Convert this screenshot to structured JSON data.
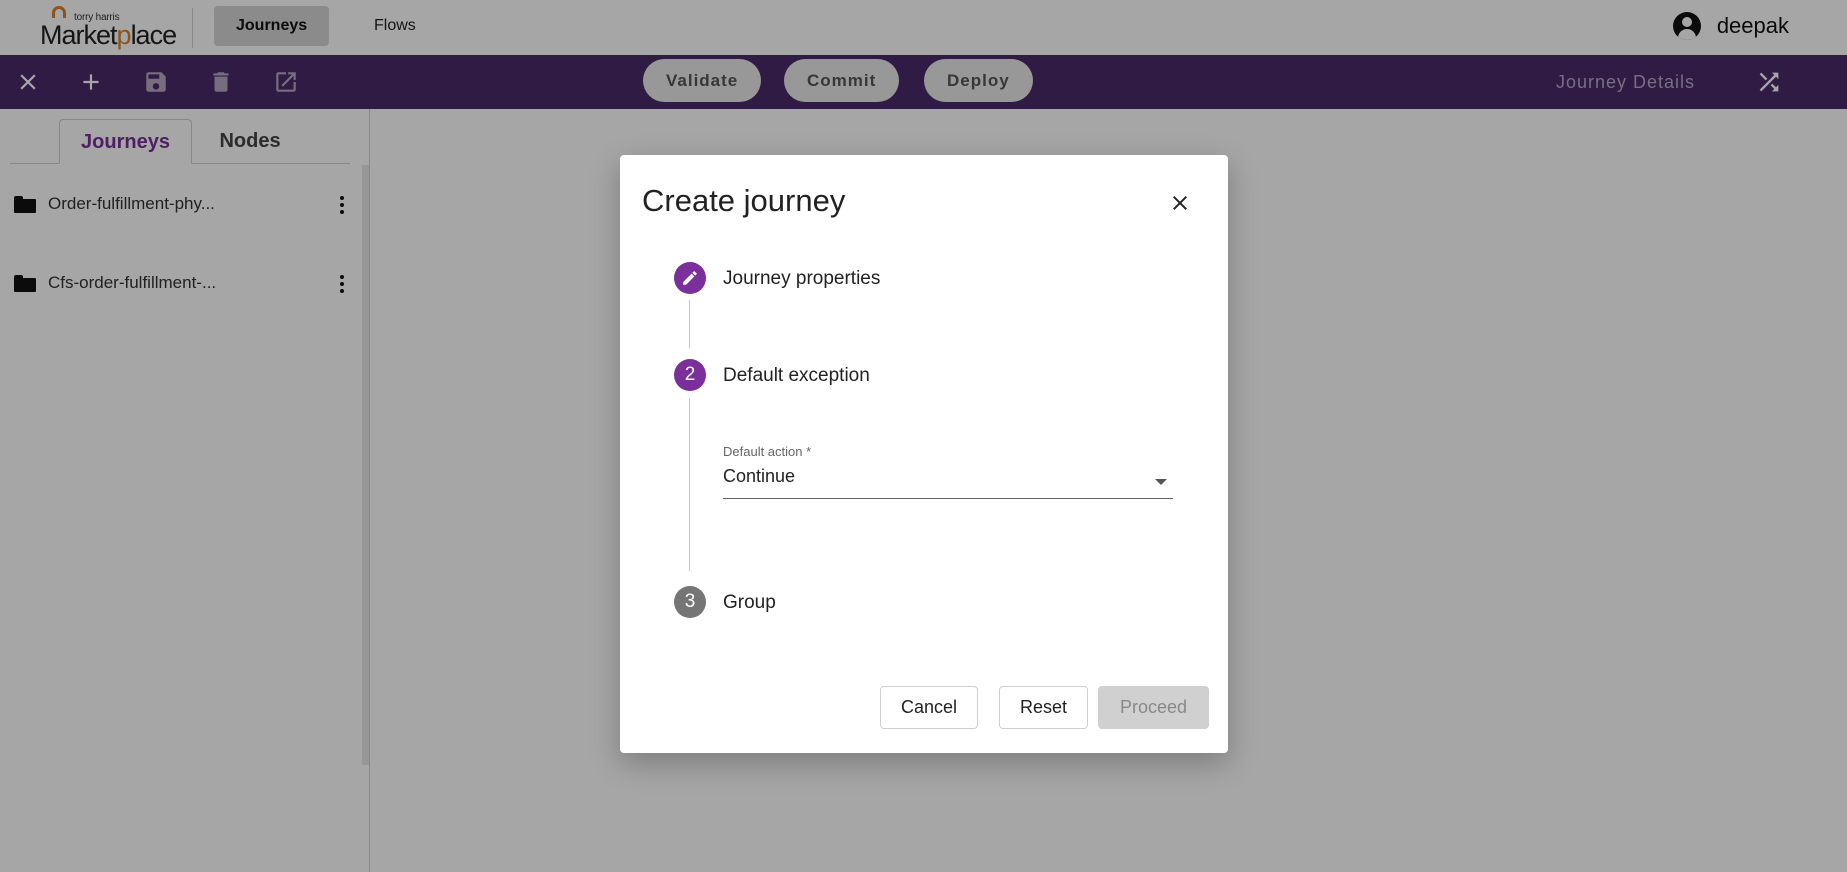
{
  "header": {
    "logo": {
      "small": "torry harris",
      "big_pre": "M",
      "big_mid": "arket",
      "big_accent": "p",
      "big_post": "lace"
    },
    "nav": [
      {
        "label": "Journeys",
        "active": true
      },
      {
        "label": "Flows",
        "active": false
      }
    ],
    "user": {
      "name": "deepak",
      "icon": "account-circle-icon"
    }
  },
  "toolbar": {
    "icons": [
      "close-icon",
      "add-icon",
      "save-icon",
      "delete-icon",
      "open-external-icon"
    ],
    "actions": [
      "Validate",
      "Commit",
      "Deploy"
    ],
    "details_label": "Journey Details",
    "shuffle_icon": "shuffle-icon",
    "background": "#4a2a6a"
  },
  "sidebar": {
    "tabs": [
      {
        "label": "Journeys",
        "active": true
      },
      {
        "label": "Nodes",
        "active": false
      }
    ],
    "items": [
      {
        "label": "Order-fulfillment-phy...",
        "icon": "folder-icon"
      },
      {
        "label": "Cfs-order-fulfillment-...",
        "icon": "folder-icon"
      }
    ]
  },
  "modal": {
    "title": "Create journey",
    "steps": [
      {
        "number": "",
        "label": "Journey properties",
        "state": "completed",
        "icon": "edit-pencil-icon"
      },
      {
        "number": "2",
        "label": "Default exception",
        "state": "active"
      },
      {
        "number": "3",
        "label": "Group",
        "state": "inactive"
      }
    ],
    "field": {
      "label": "Default action *",
      "value": "Continue"
    },
    "buttons": {
      "cancel": "Cancel",
      "reset": "Reset",
      "proceed": "Proceed"
    },
    "accent_color": "#7b2f9b"
  }
}
